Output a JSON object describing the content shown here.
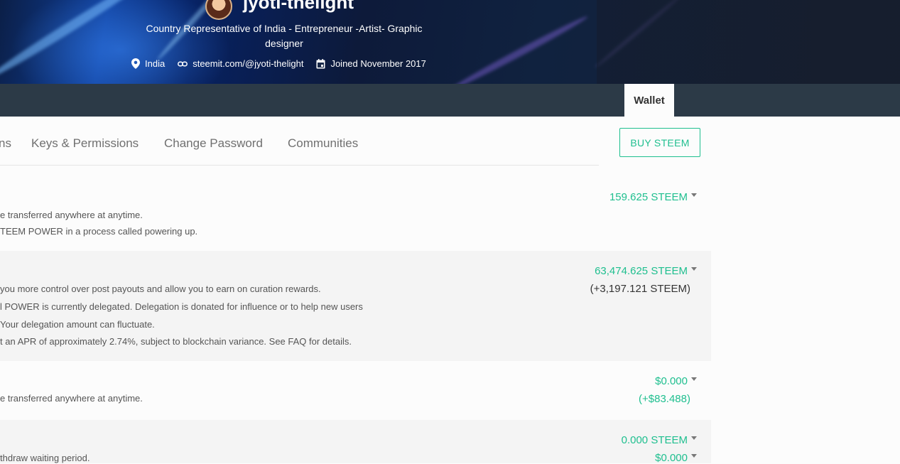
{
  "profile": {
    "name": "jyoti-thelight",
    "about": "Country Representative of India - Entrepreneur -Artist- Graphic designer",
    "location": "India",
    "website": "steemit.com/@jyoti-thelight",
    "joined": "Joined November 2017"
  },
  "nav": {
    "active_tab": "Wallet"
  },
  "subnav": {
    "items": [
      "ns",
      "Keys & Permissions",
      "Change Password",
      "Communities"
    ]
  },
  "buy_button": "BUY STEEM",
  "rows": [
    {
      "lines": [
        "e transferred anywhere at anytime.",
        "TEEM POWER in a process called powering up."
      ],
      "values": [
        "159.625 STEEM"
      ]
    },
    {
      "lines": [
        "you more control over post payouts and allow you to earn on curation rewards.",
        "l POWER is currently delegated. Delegation is donated for influence or to help new users",
        "Your delegation amount can fluctuate.",
        "t an APR of approximately 2.74%, subject to blockchain variance. See FAQ for details."
      ],
      "values": [
        "63,474.625 STEEM",
        "(+3,197.121 STEEM)"
      ]
    },
    {
      "lines": [
        "e transferred anywhere at anytime."
      ],
      "values": [
        "$0.000",
        "(+$83.488)"
      ]
    },
    {
      "lines": [
        "thdraw waiting period."
      ],
      "values": [
        "0.000 STEEM",
        "$0.000"
      ]
    }
  ],
  "colors": {
    "accent": "#1fbf8f",
    "navbar": "#2c3a47",
    "text_muted": "#555555"
  },
  "icons": [
    "location-pin-icon",
    "link-icon",
    "calendar-icon",
    "caret-down-icon"
  ]
}
